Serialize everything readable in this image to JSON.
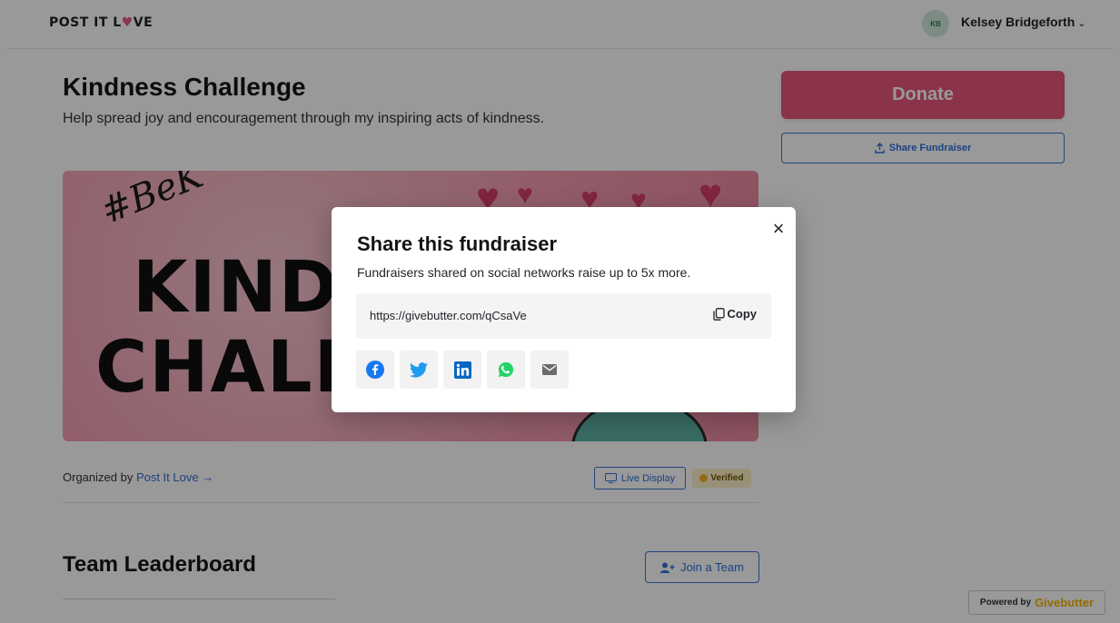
{
  "header": {
    "logo_text_a": "POST IT L",
    "logo_text_b": "VE",
    "logo_heart": "♥",
    "avatar_initials": "KB",
    "user_name": "Kelsey Bridgeforth",
    "user_chevron": "⌄"
  },
  "page": {
    "title": "Kindness Challenge",
    "subtitle": "Help spread joy and encouragement through my inspiring acts of kindness.",
    "hero": {
      "hashtag": "#BeK",
      "line1": "KINDN",
      "line2": "CHALL"
    },
    "organized_prefix": "Organized by ",
    "organizer_link": "Post It Love →",
    "live_display_label": "Live Display",
    "verified_label": "Verified",
    "leaderboard_title": "Team Leaderboard",
    "join_team_label": "Join a Team"
  },
  "sidebar": {
    "donate_label": "Donate",
    "share_label": "Share Fundraiser"
  },
  "footer": {
    "powered_prefix": "Powered by",
    "powered_brand": "Givebutter"
  },
  "modal": {
    "title": "Share this fundraiser",
    "subtitle": "Fundraisers shared on social networks raise up to 5x more.",
    "link_url": "https://givebutter.com/qCsaVe",
    "copy_label": "Copy",
    "close_glyph": "×",
    "social": [
      "facebook-icon",
      "twitter-icon",
      "linkedin-icon",
      "whatsapp-icon",
      "email-icon"
    ]
  },
  "colors": {
    "accent": "#2e6fd8",
    "donate": "#e8557a",
    "facebook": "#1877f2",
    "twitter": "#1d9bf0",
    "linkedin": "#0a66c2",
    "whatsapp": "#25d366",
    "email": "#6b6b6b"
  }
}
